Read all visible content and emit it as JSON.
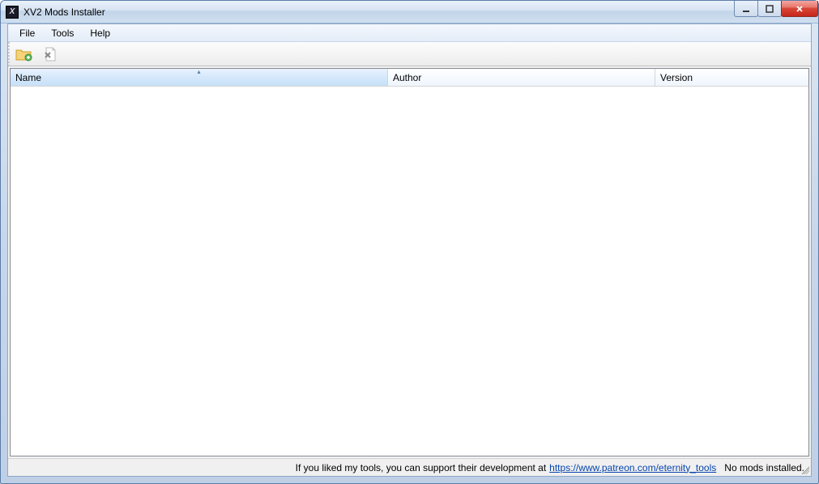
{
  "window": {
    "title": "XV2 Mods Installer"
  },
  "menu": {
    "file": "File",
    "tools": "Tools",
    "help": "Help"
  },
  "columns": {
    "name": "Name",
    "author": "Author",
    "version": "Version"
  },
  "status": {
    "support_prefix": "If you liked my tools, you can support their development at ",
    "support_link": "https://www.patreon.com/eternity_tools",
    "mods_status": "No mods installed."
  }
}
